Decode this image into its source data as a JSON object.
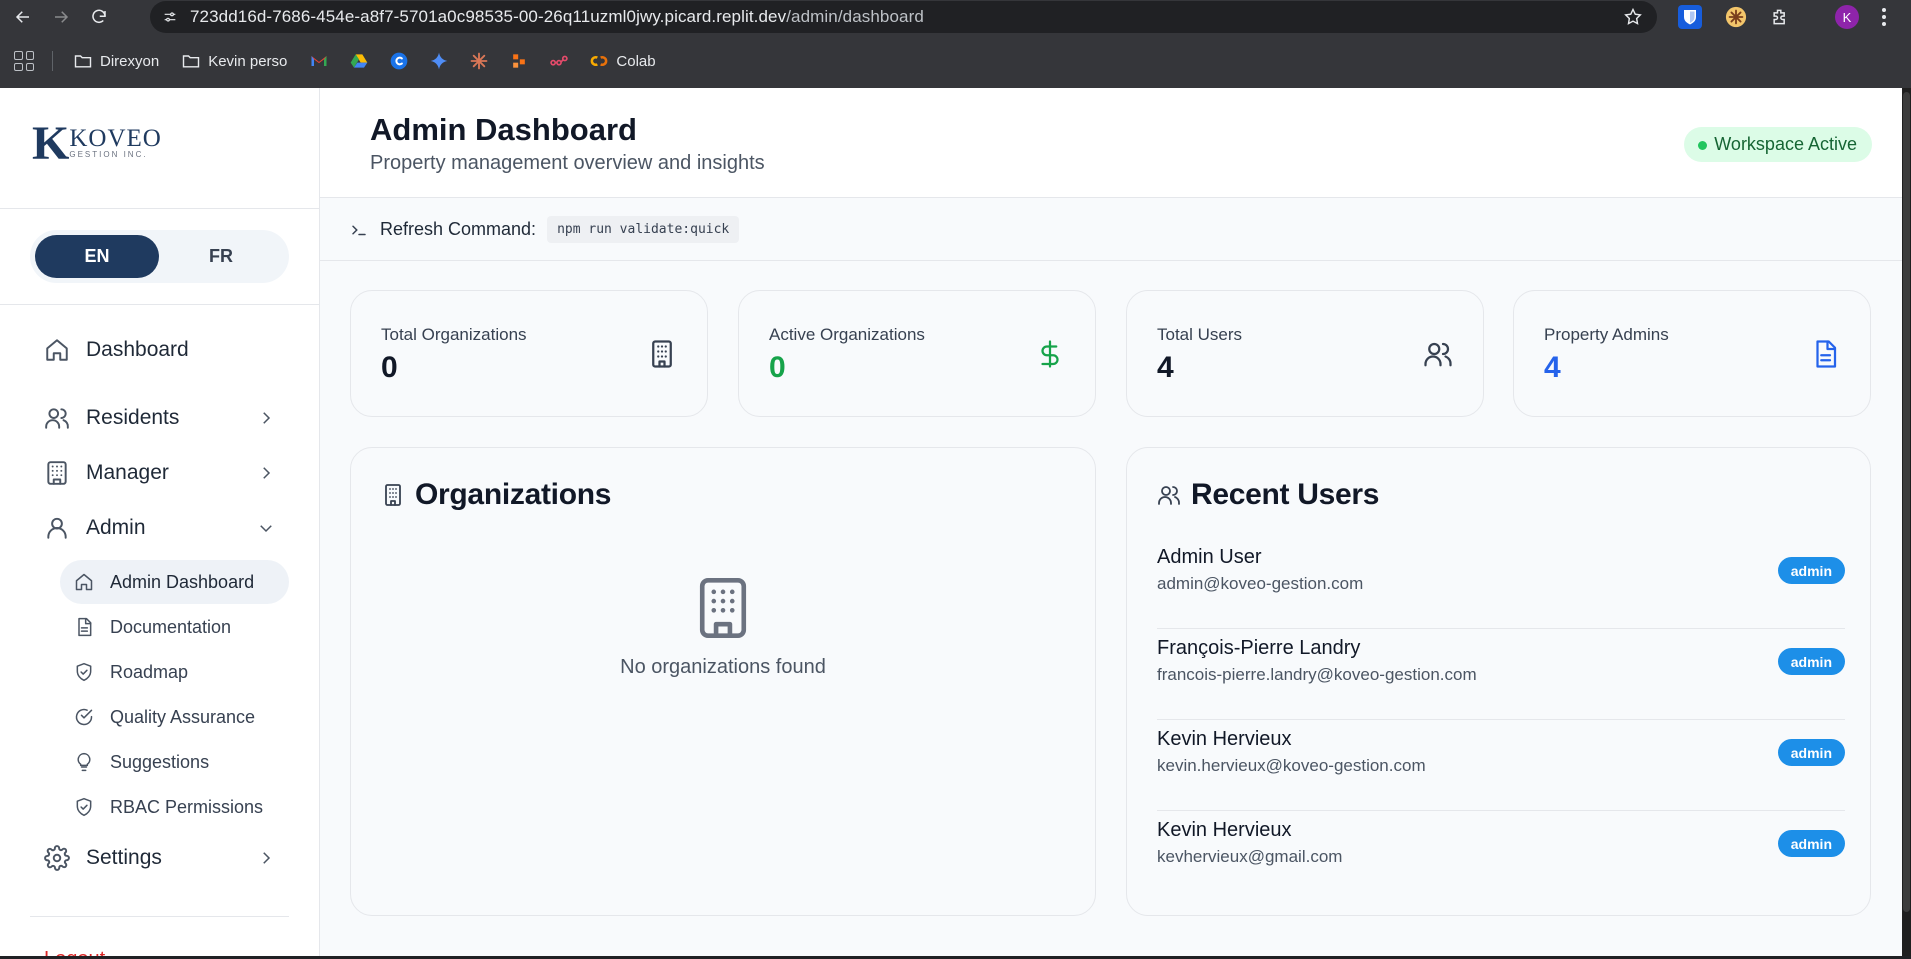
{
  "browser": {
    "url_host": "723dd16d-7686-454e-a8f7-5701a0c98535-00-26q11uzml0jwy.picard.replit.dev",
    "url_path": "/admin/dashboard",
    "profile_initial": "K",
    "bookmarks": [
      {
        "label": "Direxyon",
        "icon": "folder-icon"
      },
      {
        "label": "Kevin perso",
        "icon": "folder-icon"
      },
      {
        "label": "Colab",
        "icon": "colab-icon"
      }
    ],
    "bookmark_icons": [
      "gmail-icon",
      "google-drive-icon",
      "c-icon",
      "gemini-icon",
      "claude-icon",
      "zapier-icon",
      "link-icon"
    ]
  },
  "sidebar": {
    "logo_letter": "K",
    "logo_name": "KOVEO",
    "logo_sub": "GESTION INC.",
    "lang": {
      "en": "EN",
      "fr": "FR",
      "active": "EN"
    },
    "nav": {
      "dashboard": "Dashboard",
      "residents": "Residents",
      "manager": "Manager",
      "admin": "Admin",
      "settings": "Settings"
    },
    "admin_items": {
      "admin_dashboard": "Admin Dashboard",
      "documentation": "Documentation",
      "roadmap": "Roadmap",
      "quality": "Quality Assurance",
      "suggestions": "Suggestions",
      "rbac": "RBAC Permissions"
    },
    "logout": "Logout"
  },
  "header": {
    "title": "Admin Dashboard",
    "subtitle": "Property management overview and insights",
    "workspace_status": "Workspace Active"
  },
  "command": {
    "label": "Refresh Command:",
    "value": "npm run validate:quick"
  },
  "stats": [
    {
      "label": "Total Organizations",
      "value": "0",
      "icon": "building-icon",
      "color": "#111827"
    },
    {
      "label": "Active Organizations",
      "value": "0",
      "icon": "dollar-icon",
      "color": "#16a34a"
    },
    {
      "label": "Total Users",
      "value": "4",
      "icon": "users-icon",
      "color": "#111827"
    },
    {
      "label": "Property Admins",
      "value": "4",
      "icon": "document-icon",
      "color": "#2563eb"
    }
  ],
  "organizations": {
    "title": "Organizations",
    "empty_text": "No organizations found"
  },
  "recent_users": {
    "title": "Recent Users",
    "users": [
      {
        "name": "Admin User",
        "email": "admin@koveo-gestion.com",
        "role": "admin"
      },
      {
        "name": "François-Pierre Landry",
        "email": "francois-pierre.landry@koveo-gestion.com",
        "role": "admin"
      },
      {
        "name": "Kevin Hervieux",
        "email": "kevin.hervieux@koveo-gestion.com",
        "role": "admin"
      },
      {
        "name": "Kevin Hervieux",
        "email": "kevhervieux@gmail.com",
        "role": "admin"
      }
    ]
  },
  "colors": {
    "brand_navy": "#1f3a5f",
    "status_green": "#16a34a",
    "accent_blue": "#2563eb",
    "role_badge": "#1d8fe8"
  }
}
